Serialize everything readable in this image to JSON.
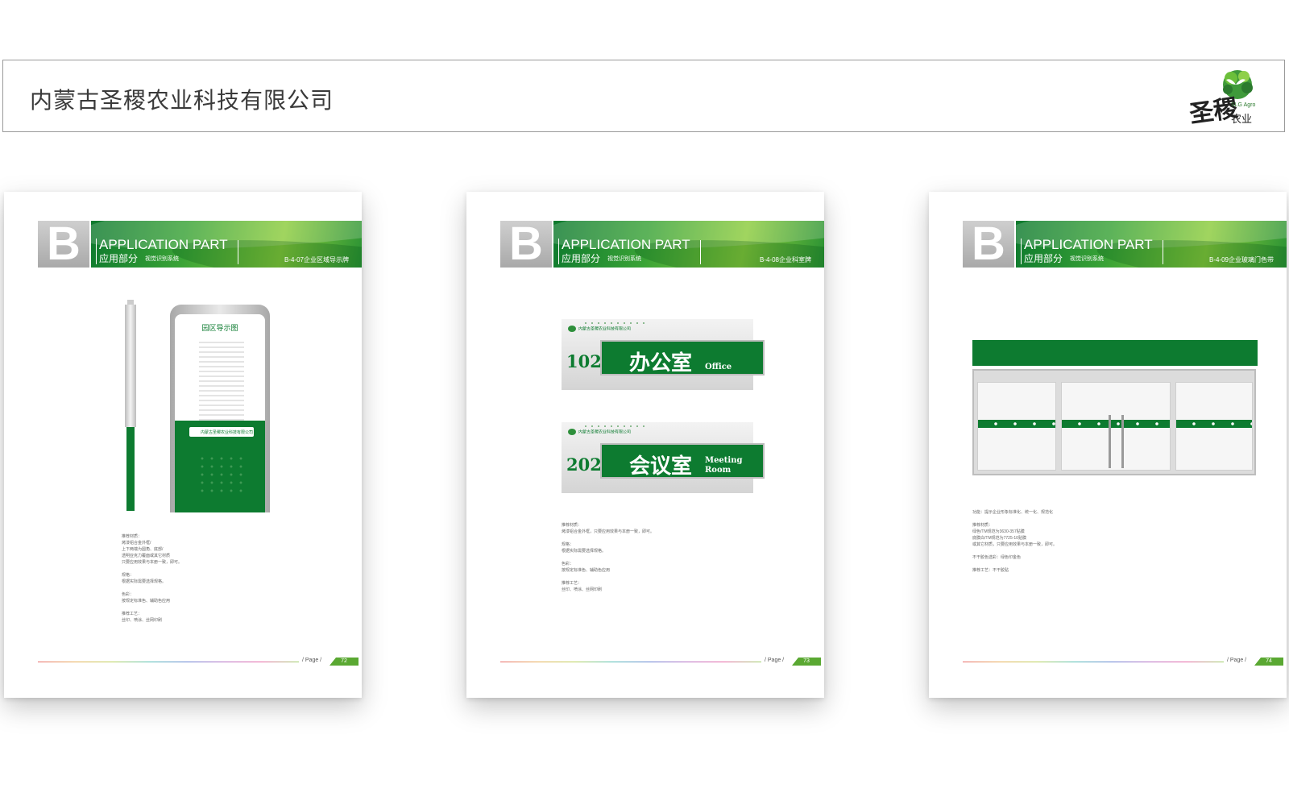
{
  "company": {
    "name": "内蒙古圣稷农业科技有限公司",
    "logo_en": "SLG Agro",
    "logo_cn": "农业",
    "logo_script": "圣稷"
  },
  "header": {
    "badge": "B",
    "title_en": "APPLICATION PART",
    "title_cn": "应用部分",
    "subtitle": "视觉识别系统"
  },
  "footer": {
    "page_label": "/ Page /"
  },
  "pages": [
    {
      "code": "B-4-07企业区域导示牌",
      "page_number": "72",
      "board_title": "园区导示图",
      "board_brand": "内蒙古圣稷农业科技有限公司",
      "notes": "推荐材质：\n烤漆铝合金外框/\n上下两端为圆角、底部/\n透明亚克力覆面或其它材质\n只要应用效果与本册一致，即可。\n\n规格：\n根据实际需要选择规格。\n\n色彩：\n按规定标准色、辅助色应用\n\n推荐工艺：\n丝印、喷涂、丝网印刷"
    },
    {
      "code": "B-4-08企业科室牌",
      "page_number": "73",
      "signs": [
        {
          "number": "102",
          "cn": "办公室",
          "en": "Office",
          "brand": "内蒙古圣稷农业科技有限公司"
        },
        {
          "number": "202",
          "cn": "会议室",
          "en": "Meeting Room",
          "brand": "内蒙古圣稷农业科技有限公司"
        }
      ],
      "notes": "推荐材质：\n烤漆铝合金外框，只要应用效果与本册一致，即可。\n\n规格：\n根据实际需要选择规格。\n\n色彩：\n按规定标准色、辅助色应用\n\n推荐工艺：\n丝印、喷涂、丝网印刷"
    },
    {
      "code": "B-4-09企业玻璃门色带",
      "page_number": "74",
      "notes": "功能：提示企业形象标准化、统一化、规范化\n\n推荐材质：\n绿色/TM规范为3630-357贴膜\n底膜白/TM规范为7725-10贴膜\n或其它材质，只要应用效果与本册一致，即可。\n\n不干胶色选彩：绿色印金色\n\n推荐工艺：不干胶贴"
    }
  ]
}
